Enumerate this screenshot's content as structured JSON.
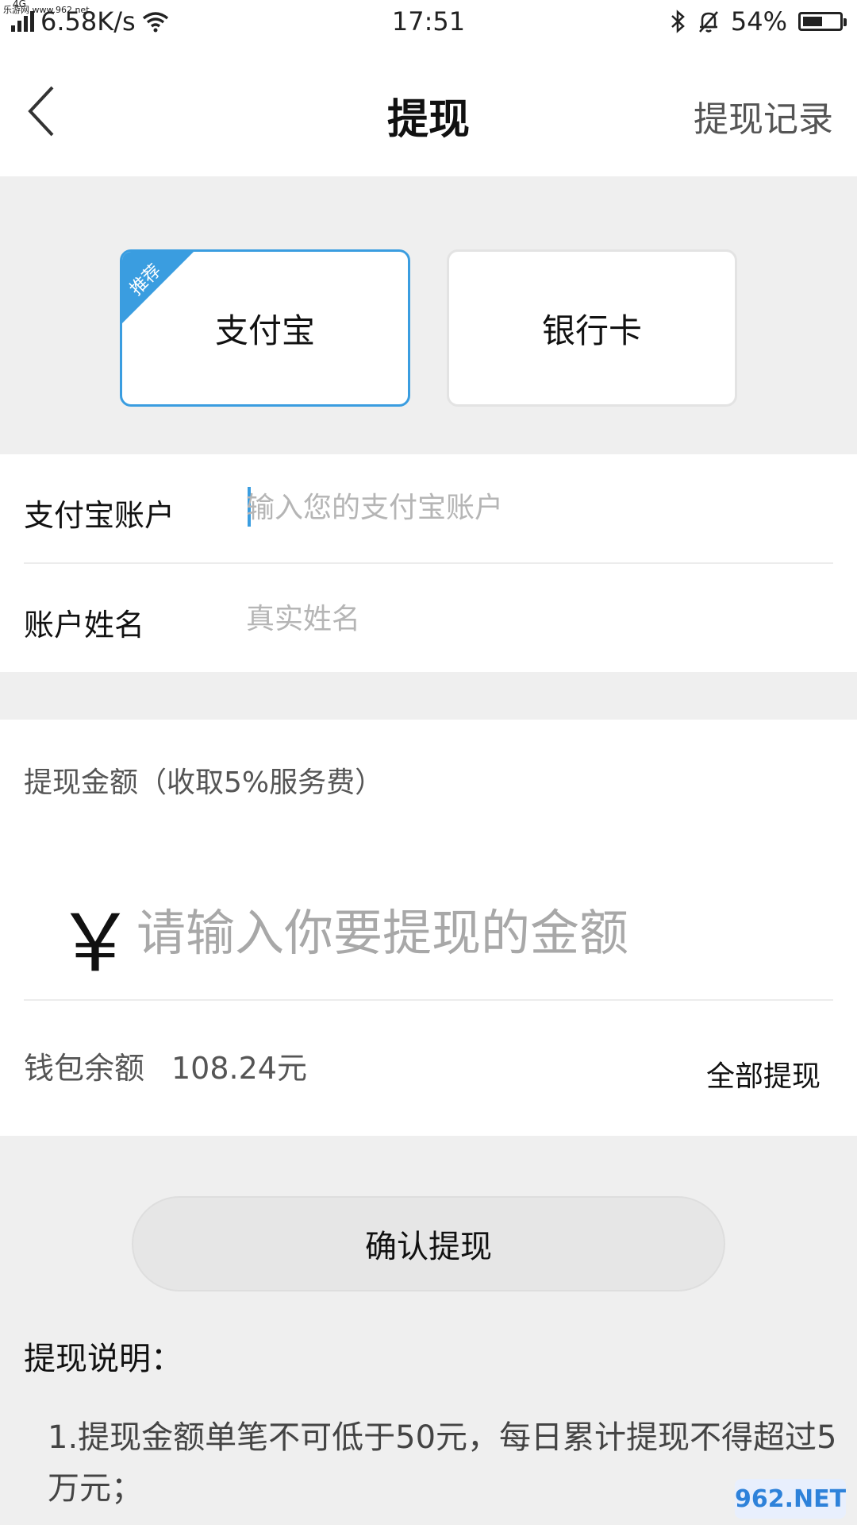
{
  "watermark": {
    "top_text": "乐游网 www.962.net",
    "logo_text": "962.NET"
  },
  "status_bar": {
    "network_tag": "4G",
    "speed": "6.58K/s",
    "time": "17:51",
    "battery": "54%",
    "battery_level": 0.54
  },
  "header": {
    "title": "提现",
    "record_link": "提现记录"
  },
  "methods": {
    "alipay_label": "支付宝",
    "bank_label": "银行卡",
    "recommend_badge": "推荐",
    "selected": "alipay",
    "accent_color": "#3a9de0"
  },
  "account": {
    "account_label": "支付宝账户",
    "account_placeholder": "输入您的支付宝账户",
    "name_label": "账户姓名",
    "name_placeholder": "真实姓名"
  },
  "amount": {
    "label": "提现金额（收取5%服务费）",
    "currency_symbol": "￥",
    "placeholder": "请输入你要提现的金额",
    "balance_label": "钱包余额",
    "balance_value": "108.24元",
    "withdraw_all": "全部提现"
  },
  "confirm_button": "确认提现",
  "notes": {
    "title": "提现说明：",
    "line1": "1.提现金额单笔不可低于50元，每日累计提现不得超过5万元；"
  }
}
